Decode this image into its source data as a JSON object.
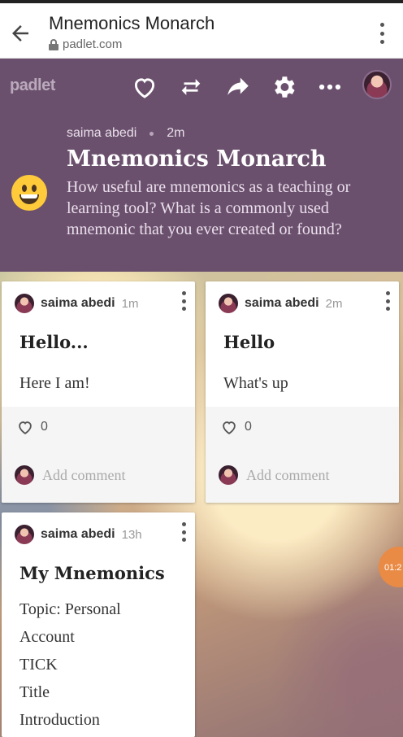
{
  "browser": {
    "title": "Mnemonics Monarch",
    "url": "padlet.com"
  },
  "header": {
    "logo": "padlet",
    "author": "saima abedi",
    "time": "2m",
    "title": "Mnemonics Monarch",
    "description": "How useful are mnemonics as a teaching or learning tool? What is a commonly used mnemonic that you ever created or found?"
  },
  "posts": [
    {
      "author": "saima abedi",
      "time": "1m",
      "title": "Hello...",
      "body": "Here I am!",
      "likes": "0",
      "comment_placeholder": "Add comment"
    },
    {
      "author": "saima abedi",
      "time": "2m",
      "title": "Hello",
      "body": "What's up",
      "likes": "0",
      "comment_placeholder": "Add comment"
    },
    {
      "author": "saima abedi",
      "time": "13h",
      "title": "My Mnemonics",
      "body": "Topic: Personal\nAccount\nTICK\nTitle\nIntroduction"
    }
  ],
  "timer": "01:2",
  "colors": {
    "header_bg": "#6b506e",
    "emoji": "#ffcb3a",
    "timer": "#e98a45"
  },
  "icons": [
    "back-arrow-icon",
    "lock-icon",
    "more-vert-icon",
    "heart-icon",
    "remix-icon",
    "share-icon",
    "gear-icon",
    "more-horiz-icon"
  ]
}
